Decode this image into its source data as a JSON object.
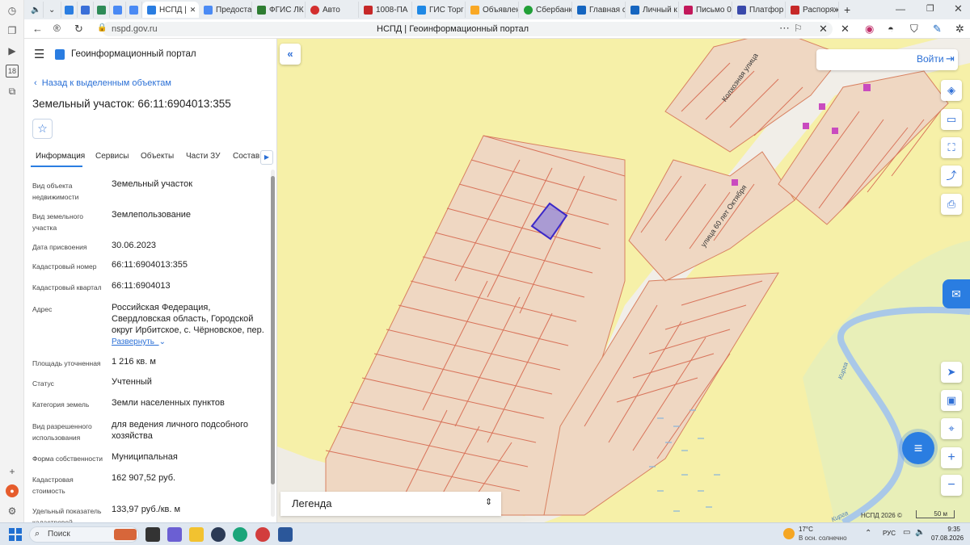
{
  "browser": {
    "tabs": [
      {
        "label": "",
        "color": "#e0e0e0"
      },
      {
        "label": "НСПД |",
        "color": "#2a7de1",
        "active": true
      },
      {
        "label": "Предоста",
        "color": "#4a8af4"
      },
      {
        "label": "ФГИС ЛК",
        "color": "#2e7d32"
      },
      {
        "label": "Авто",
        "color": "#d32f2f"
      },
      {
        "label": "1008-ПА",
        "color": "#c62828"
      },
      {
        "label": "ГИС Торг",
        "color": "#1e88e5"
      },
      {
        "label": "Объявлен",
        "color": "#f9a825"
      },
      {
        "label": "Сбербанк",
        "color": "#21a038"
      },
      {
        "label": "Главная с",
        "color": "#1565c0"
      },
      {
        "label": "Личный к",
        "color": "#1565c0"
      },
      {
        "label": "Письмо 0",
        "color": "#c2185b"
      },
      {
        "label": "Платфор",
        "color": "#3949ab"
      },
      {
        "label": "Распоряж",
        "color": "#c62828"
      }
    ],
    "url": "nspd.gov.ru",
    "page_title": "НСПД | Геоинформационный портал"
  },
  "panel": {
    "portal_title": "Геоинформационный портал",
    "back_link": "Назад к выделенным объектам",
    "heading": "Земельный участок: 66:11:6904013:355",
    "tabs": [
      "Информация",
      "Сервисы",
      "Объекты",
      "Части ЗУ",
      "Состав"
    ],
    "fields": [
      {
        "label": "Вид объекта недвижимости",
        "value": "Земельный участок"
      },
      {
        "label": "Вид земельного участка",
        "value": "Землепользование"
      },
      {
        "label": "Дата присвоения",
        "value": "30.06.2023"
      },
      {
        "label": "Кадастровый номер",
        "value": "66:11:6904013:355"
      },
      {
        "label": "Кадастровый квартал",
        "value": "66:11:6904013"
      },
      {
        "label": "Адрес",
        "value": "Российская Федерация, Свердловская область, Городской округ Ирбитское, с. Чёрновское, пер."
      },
      {
        "label": "Площадь уточненная",
        "value": "1 216 кв. м"
      },
      {
        "label": "Статус",
        "value": "Учтенный"
      },
      {
        "label": "Категория земель",
        "value": "Земли населенных пунктов"
      },
      {
        "label": "Вид разрешенного использования",
        "value": "для ведения личного подсобного хозяйства"
      },
      {
        "label": "Форма собственности",
        "value": "Муниципальная"
      },
      {
        "label": "Кадастровая стоимость",
        "value": "162 907,52 руб."
      },
      {
        "label": "Удельный показатель кадастровой",
        "value": "133,97 руб./кв. м"
      }
    ],
    "expand_link": "Развернуть"
  },
  "map": {
    "login_label": "Войти",
    "legend_label": "Легенда",
    "street_1": "Колхозная улица",
    "street_2": "улица 60 лет Октября",
    "river_1": "Кирга",
    "river_2": "Кирга",
    "attribution": "НСПД 2026 ©",
    "scale": "50 м"
  },
  "taskbar": {
    "search_placeholder": "Поиск",
    "weather_temp": "17°C",
    "weather_desc": "В осн. солнечно",
    "lang": "РУС",
    "time": "9:35",
    "date": "07.08.2026"
  }
}
